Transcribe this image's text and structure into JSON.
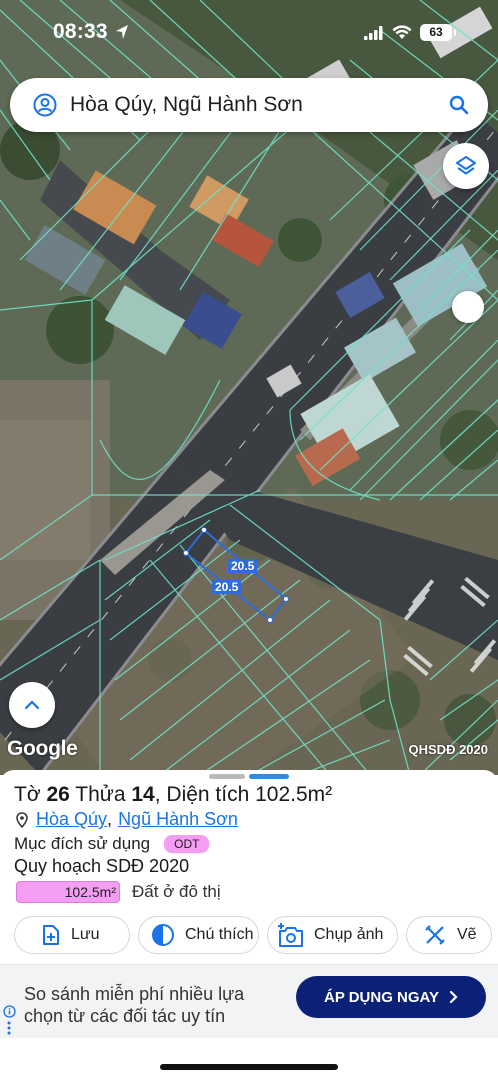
{
  "status_bar": {
    "time": "08:33",
    "battery": "63"
  },
  "search": {
    "query": "Hòa Qúy, Ngũ Hành Sơn"
  },
  "map": {
    "brand": "Google",
    "source": "QHSDĐ 2020",
    "dimension_labels": [
      "20.5",
      "20.5"
    ],
    "colors": {
      "parcel_lines": "#6fe3c8",
      "selected_parcel": "#2e6cd9"
    }
  },
  "parcel": {
    "title_prefix": "Tờ",
    "sheet_number": "26",
    "title_mid": "Thửa",
    "plot_number": "14",
    "title_suffix": ", Diện tích",
    "area": "102.5m²",
    "ward": "Hòa Qúy",
    "district": "Ngũ Hành Sơn",
    "purpose_label": "Mục đích sử dụng",
    "purpose_code": "ODT",
    "plan_label": "Quy hoạch SDĐ 2020",
    "plan_area": "102.5m²",
    "plan_use": "Đất ở đô thị",
    "color_odt": "#f59df3"
  },
  "actions": [
    {
      "label": "Lưu",
      "icon": "add-file-icon"
    },
    {
      "label": "Chú thích",
      "icon": "contrast-icon"
    },
    {
      "label": "Chụp ảnh",
      "icon": "add-photo-icon"
    },
    {
      "label": "Vẽ",
      "icon": "draw-ruler-icon"
    }
  ],
  "ad": {
    "line1": "So sánh miễn phí nhiều lựa",
    "line2": "chọn từ các đối tác uy tín",
    "cta": "ÁP DỤNG NGAY",
    "cta_color": "#0b2077"
  }
}
